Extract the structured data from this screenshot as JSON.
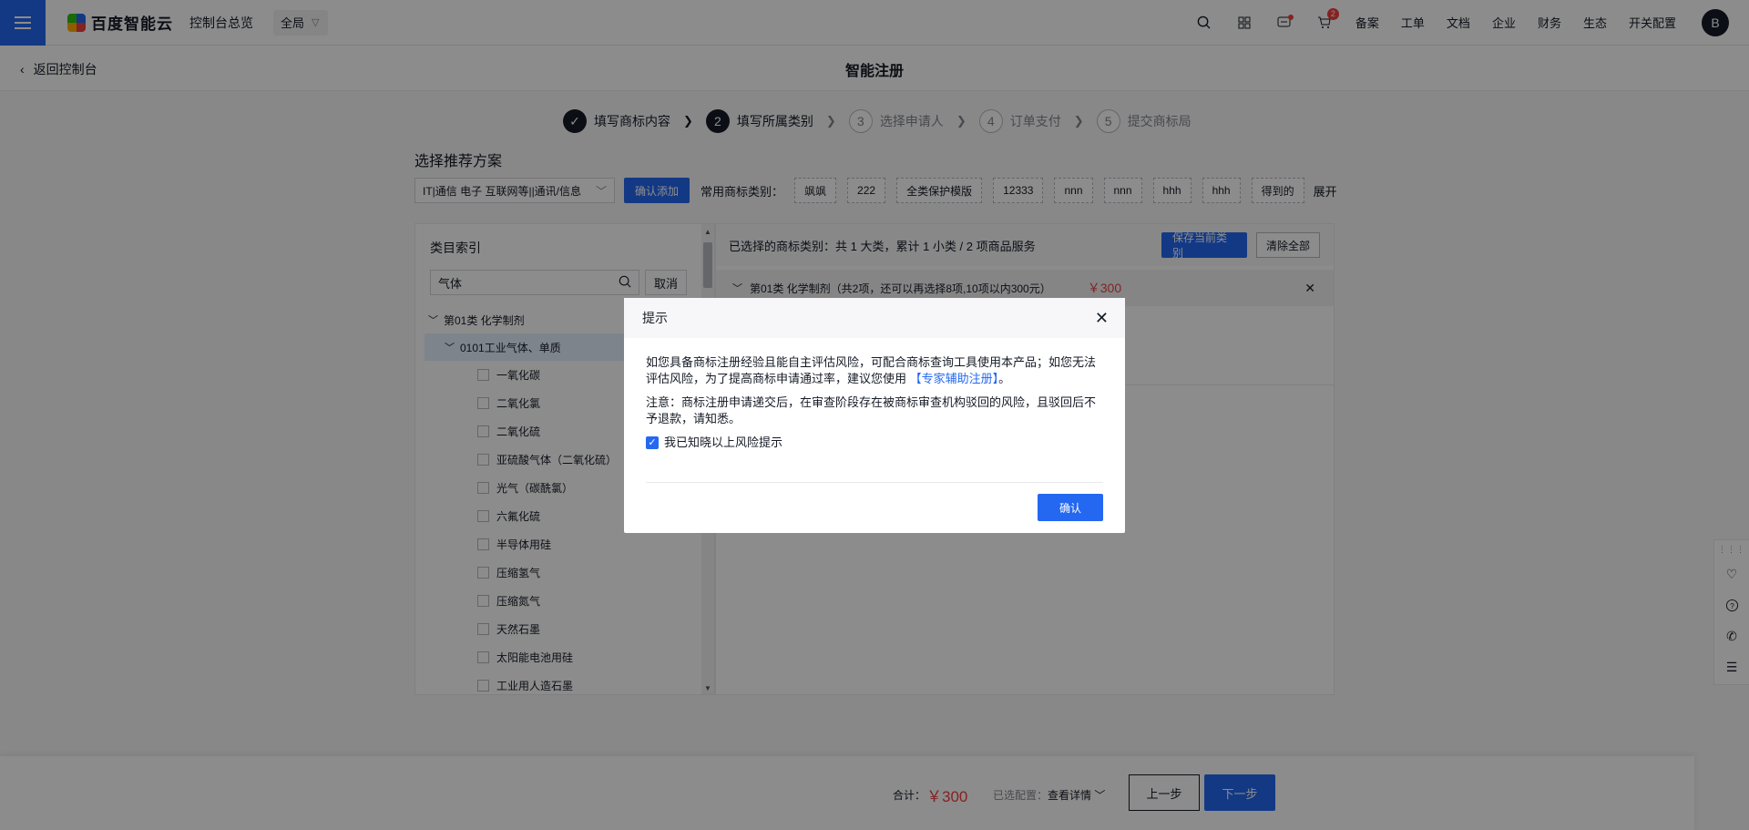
{
  "topnav": {
    "logo": "百度智能云",
    "console": "控制台总览",
    "region": "全局",
    "cart_badge": "2",
    "links": [
      "备案",
      "工单",
      "文档",
      "企业",
      "财务",
      "生态",
      "开关配置"
    ],
    "avatar": "B"
  },
  "subheader": {
    "back": "返回控制台",
    "title": "智能注册"
  },
  "steps": [
    {
      "num": "✓",
      "label": "填写商标内容"
    },
    {
      "num": "2",
      "label": "填写所属类别"
    },
    {
      "num": "3",
      "label": "选择申请人"
    },
    {
      "num": "4",
      "label": "订单支付"
    },
    {
      "num": "5",
      "label": "提交商标局"
    }
  ],
  "recommend": {
    "title": "选择推荐方案",
    "selected": "IT|通信 电子 互联网等||通讯/信息",
    "add_label": "确认添加",
    "common_label": "常用商标类别：",
    "tags": [
      "飒飒",
      "222",
      "全类保护模版",
      "12333",
      "nnn",
      "nnn",
      "hhh",
      "hhh",
      "得到的"
    ],
    "expand": "展开"
  },
  "category": {
    "title": "类目索引",
    "search_value": "气体",
    "cancel": "取消",
    "class1": "第01类 化学制剂",
    "group": "0101工业气体、单质",
    "items": [
      "一氧化碳",
      "二氧化氯",
      "二氧化硫",
      "亚硫酸气体（二氧化硫）",
      "光气（碳酰氯）",
      "六氟化硫",
      "半导体用硅",
      "压缩氢气",
      "压缩氮气",
      "天然石墨",
      "太阳能电池用硅",
      "工业用人造石墨"
    ]
  },
  "selected": {
    "summary": "已选择的商标类别：共 1 大类，累计 1 小类 / 2 项商品服务",
    "save": "保存当前类别",
    "clear": "清除全部",
    "cat": "第01类 化学制剂（共2项，还可以再选择8项,10项以内300元）",
    "price": "￥300"
  },
  "footer": {
    "total_label": "合计：",
    "total_price": "￥300",
    "cfg_label": "已选配置：",
    "cfg_link": "查看详情",
    "prev": "上一步",
    "next": "下一步"
  },
  "dialog": {
    "title": "提示",
    "para1a": "如您具备商标注册经验且能自主评估风险，可配合商标查询工具使用本产品；如您无法评估风险，为了提高商标申请通过率，建议您使用",
    "para1_link": "【专家辅助注册】",
    "para1b": "。",
    "para2": "注意：商标注册申请递交后，在审查阶段存在被商标审查机构驳回的风险，且驳回后不予退款，请知悉。",
    "check_label": "我已知晓以上风险提示",
    "ok": "确认"
  },
  "colors": {
    "primary": "#2468f2",
    "price": "#f33e3e"
  }
}
